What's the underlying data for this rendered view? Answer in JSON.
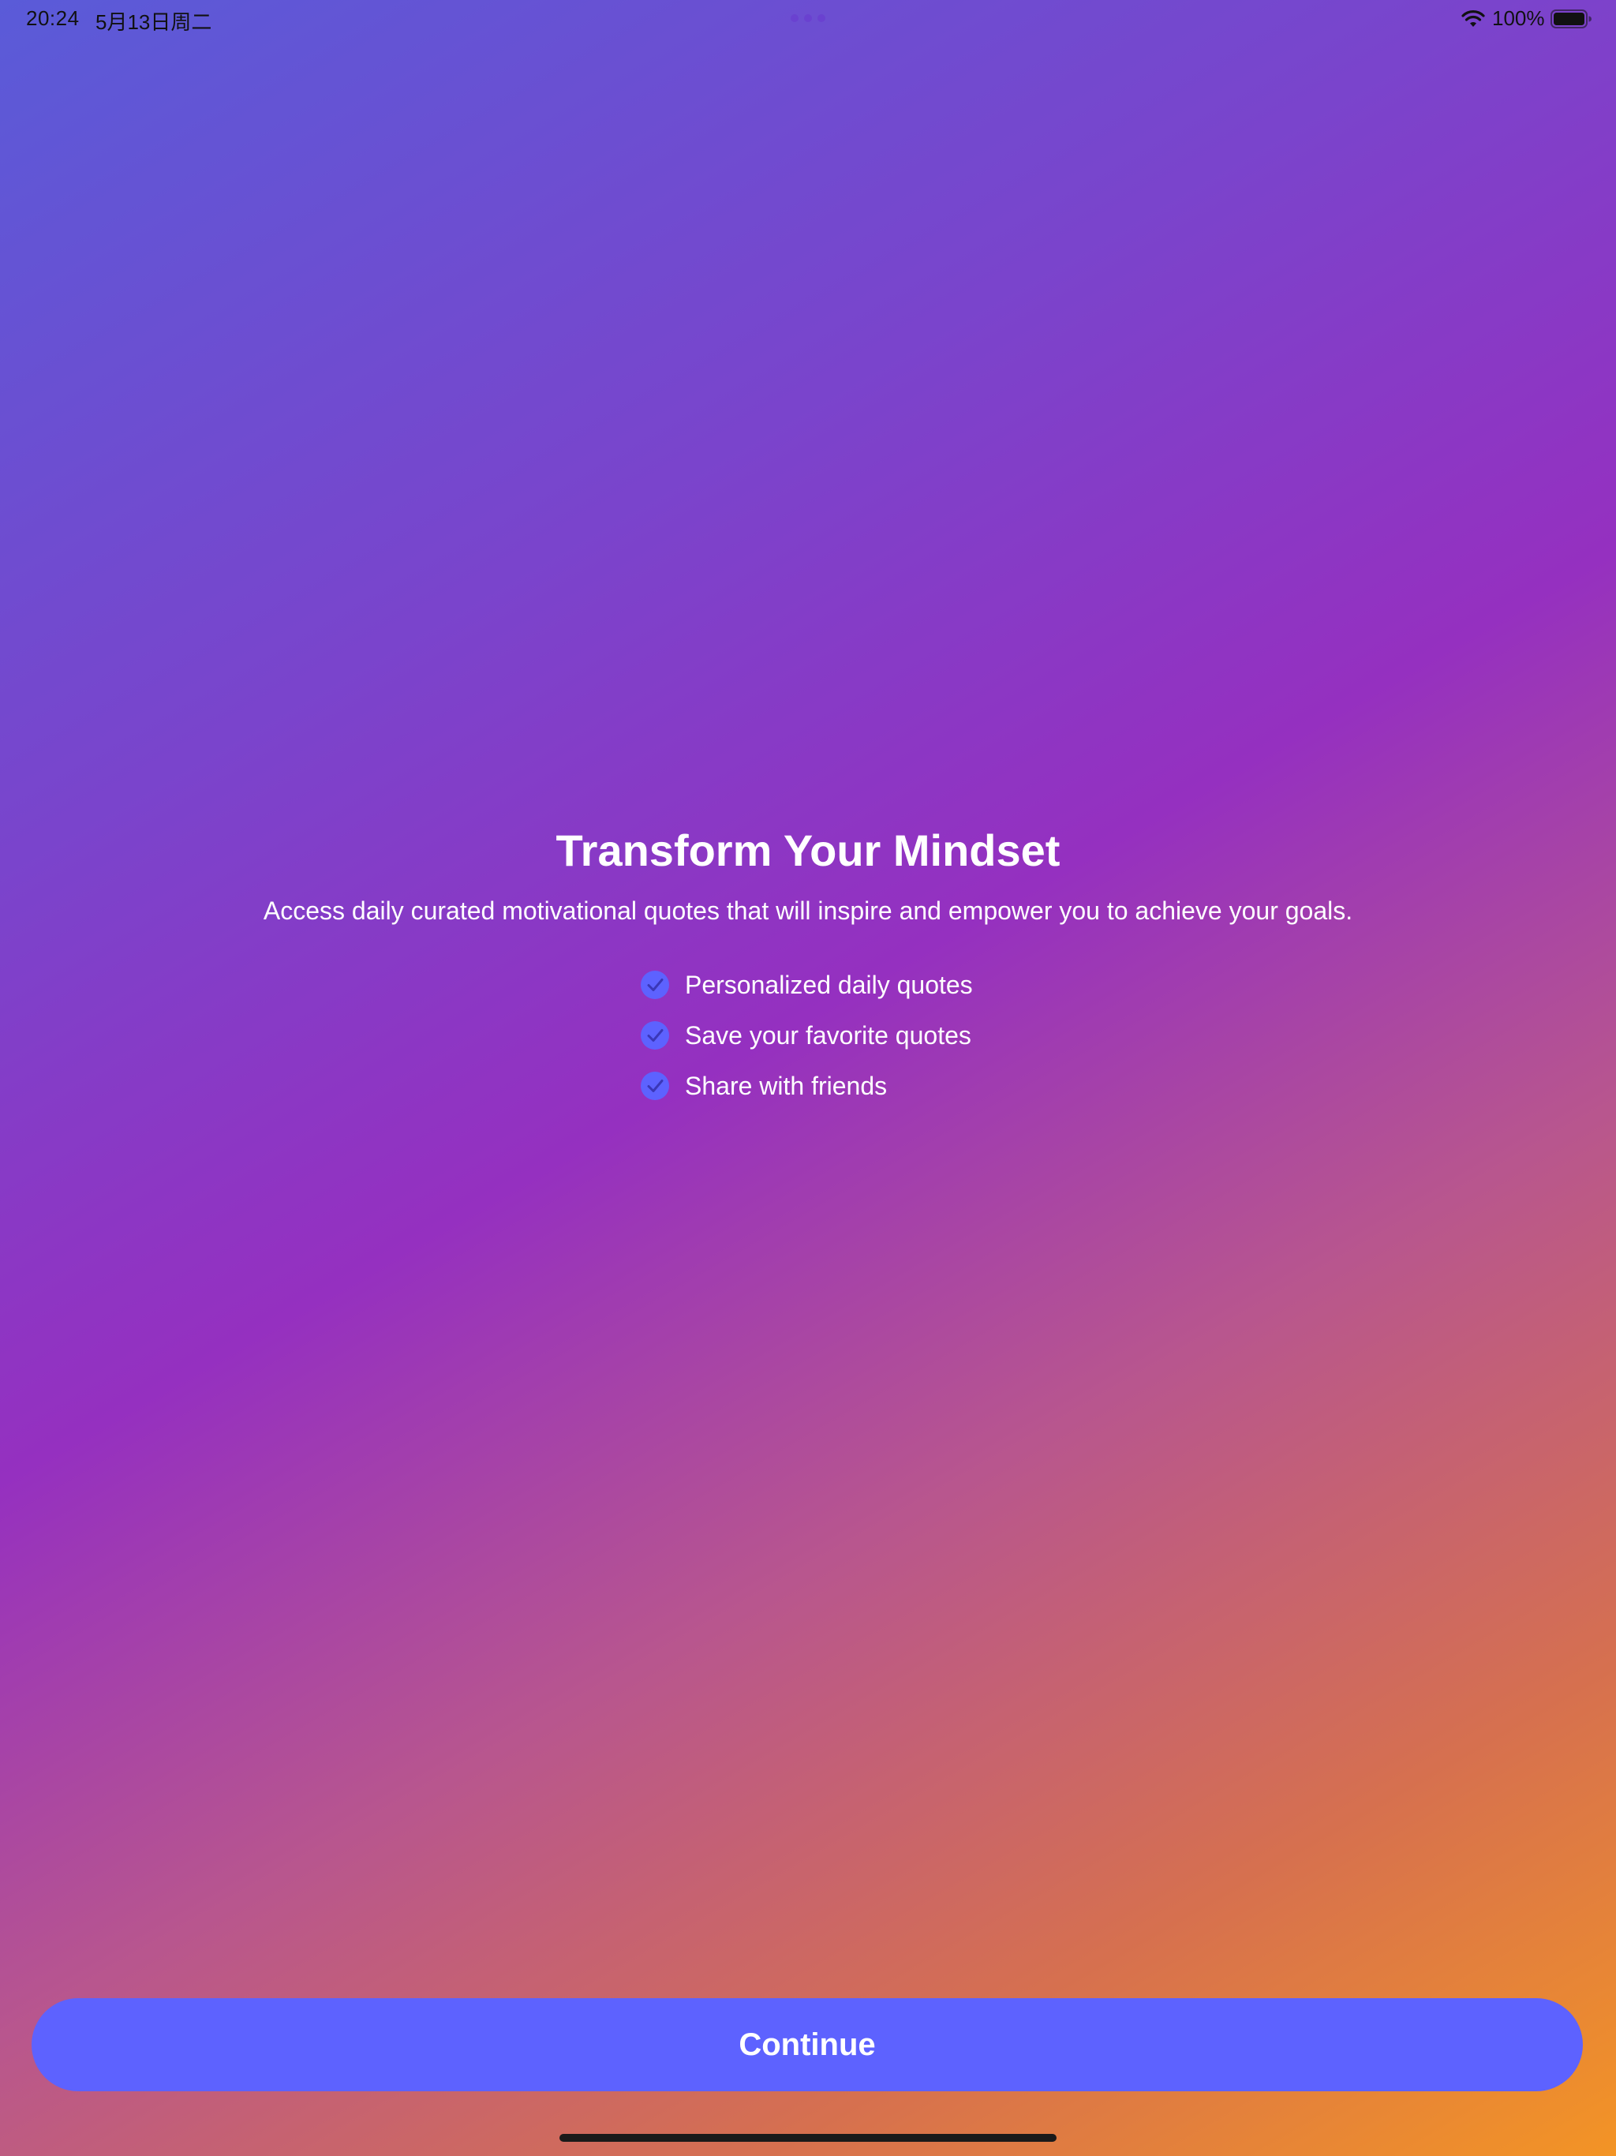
{
  "status_bar": {
    "time": "20:24",
    "date": "5月13日周二",
    "battery_percent": "100%",
    "battery_level": 1.0
  },
  "onboarding": {
    "title": "Transform Your Mindset",
    "subtitle": "Access daily curated motivational quotes that will inspire and empower you to achieve your goals.",
    "features": [
      {
        "label": "Personalized daily quotes",
        "icon": "checkmark-circle-icon"
      },
      {
        "label": "Save your favorite quotes",
        "icon": "checkmark-circle-icon"
      },
      {
        "label": "Share with friends",
        "icon": "checkmark-circle-icon"
      }
    ]
  },
  "continue_button": {
    "label": "Continue"
  },
  "colors": {
    "accent": "#5d62ff",
    "gradient_start": "#5a5bd8",
    "gradient_mid": "#9530c0",
    "gradient_end": "#f39425"
  }
}
